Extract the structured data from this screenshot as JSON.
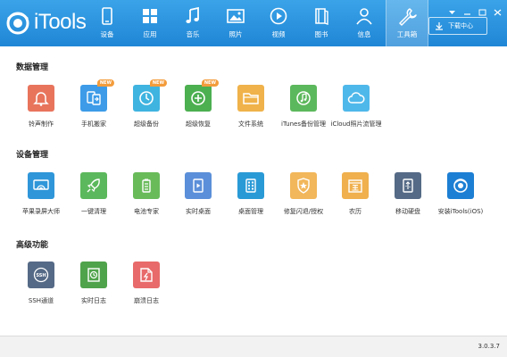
{
  "app": {
    "brand": "iTools"
  },
  "nav": [
    {
      "label": "设备",
      "icon": "phone-icon"
    },
    {
      "label": "应用",
      "icon": "apps-grid-icon"
    },
    {
      "label": "音乐",
      "icon": "music-note-icon"
    },
    {
      "label": "照片",
      "icon": "photo-icon"
    },
    {
      "label": "视频",
      "icon": "play-circle-icon"
    },
    {
      "label": "图书",
      "icon": "book-icon"
    },
    {
      "label": "信息",
      "icon": "person-icon"
    },
    {
      "label": "工具箱",
      "icon": "wrench-icon",
      "active": true
    }
  ],
  "download_center": {
    "label": "下载中心",
    "icon": "download-icon"
  },
  "sections": {
    "data": {
      "title": "数据管理",
      "tools": [
        {
          "label": "铃声制作",
          "icon": "bell-icon",
          "color": "#e8745c"
        },
        {
          "label": "手机搬家",
          "icon": "phone-transfer-icon",
          "color": "#3d9be8",
          "badge": "NEW"
        },
        {
          "label": "超级备份",
          "icon": "clock-icon",
          "color": "#3fb4e0",
          "badge": "NEW"
        },
        {
          "label": "超级恢复",
          "icon": "restore-plus-icon",
          "color": "#4caf50",
          "badge": "NEW"
        },
        {
          "label": "文件系统",
          "icon": "folder-icon",
          "color": "#f0b24a"
        },
        {
          "label": "iTunes备份管理",
          "icon": "itunes-icon",
          "color": "#5cb85c"
        },
        {
          "label": "iCloud照片流管理",
          "icon": "cloud-icon",
          "color": "#4fb8ea"
        }
      ]
    },
    "device": {
      "title": "设备管理",
      "tools": [
        {
          "label": "苹果录屏大师",
          "icon": "screen-cast-icon",
          "color": "#2f96d9"
        },
        {
          "label": "一键清理",
          "icon": "rocket-icon",
          "color": "#5cb85c"
        },
        {
          "label": "电池专家",
          "icon": "battery-icon",
          "color": "#69bb5a"
        },
        {
          "label": "实时桌面",
          "icon": "live-desktop-icon",
          "color": "#5b8fd9"
        },
        {
          "label": "桌面管理",
          "icon": "desktop-grid-icon",
          "color": "#2a9ad6"
        },
        {
          "label": "修复闪退/授权",
          "icon": "repair-badge-icon",
          "color": "#f2b75b"
        },
        {
          "label": "农历",
          "icon": "calendar-icon",
          "color": "#f0b04e"
        },
        {
          "label": "移动硬盘",
          "icon": "usb-drive-icon",
          "color": "#556a86"
        },
        {
          "label": "安装iTools(iOS)",
          "icon": "itools-install-icon",
          "color": "#1d7fd3"
        }
      ]
    },
    "advanced": {
      "title": "高级功能",
      "tools": [
        {
          "label": "SSH通道",
          "icon": "ssh-icon",
          "color": "#556a86"
        },
        {
          "label": "实时日志",
          "icon": "log-clock-icon",
          "color": "#4fa34b"
        },
        {
          "label": "崩溃日志",
          "icon": "crash-log-icon",
          "color": "#e86a6a"
        }
      ]
    }
  },
  "footer": {
    "version": "3.0.3.7"
  }
}
